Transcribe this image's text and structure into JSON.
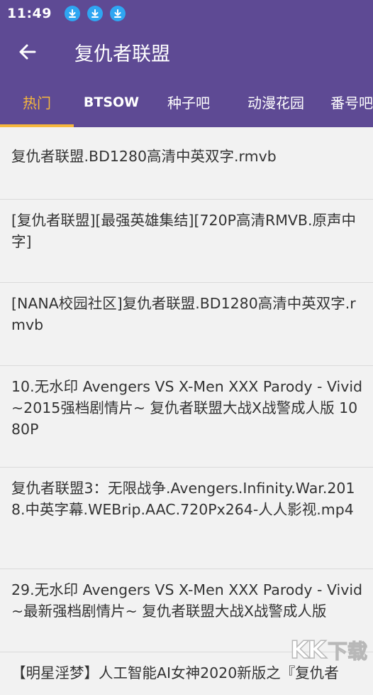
{
  "status": {
    "time": "11:49",
    "icons": [
      "download-icon",
      "download-icon",
      "download-icon"
    ]
  },
  "appbar": {
    "title": "复仇者联盟",
    "back_icon": "arrow-left-icon"
  },
  "tabs": [
    {
      "label": "热门",
      "active": true
    },
    {
      "label": "BTSOW",
      "active": false
    },
    {
      "label": "种子吧",
      "active": false
    },
    {
      "label": "动漫花园",
      "active": false
    },
    {
      "label": "番号吧",
      "active": false
    }
  ],
  "results": [
    "复仇者联盟.BD1280高清中英双字.rmvb",
    "[复仇者联盟][最强英雄集结][720P高清RMVB.原声中字]",
    "[NANA校园社区]复仇者联盟.BD1280高清中英双字.rmvb",
    "10.无水印 Avengers VS X-Men XXX Parody - Vivid ~2015强档剧情片~ 复仇者联盟大战X战警成人版 1080P",
    "复仇者联盟3：无限战争.Avengers.Infinity.War.2018.中英字幕.WEBrip.AAC.720Px264-人人影视.mp4",
    "29.无水印 Avengers VS X-Men XXX Parody - Vivid ~最新强档剧情片~ 复仇者联盟大战X战警成人版",
    "【明星淫梦】人工智能AI女神2020新版之『复仇者"
  ],
  "watermark": {
    "brand": "KK",
    "text": "下载"
  },
  "colors": {
    "primary": "#5e4a94",
    "accent": "#f6b73c",
    "download_badge": "#2fa6f2",
    "background": "#f2f2f2",
    "text": "#333333"
  }
}
